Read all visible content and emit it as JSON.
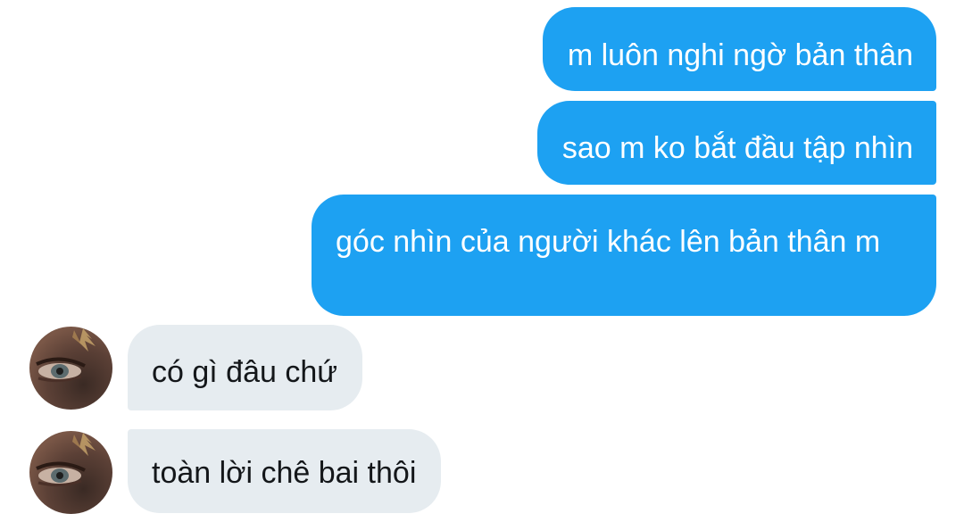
{
  "messages": [
    {
      "direction": "sent",
      "text": "m luôn nghi ngờ bản thân"
    },
    {
      "direction": "sent",
      "text": "sao m ko bắt đầu tập nhìn"
    },
    {
      "direction": "sent",
      "text": "góc nhìn của người khác lên bản thân m"
    },
    {
      "direction": "received",
      "text": "có gì đâu chứ"
    },
    {
      "direction": "received",
      "text": "toàn lời chê bai thôi"
    }
  ],
  "colors": {
    "sent_bubble": "#1da1f2",
    "sent_text": "#ffffff",
    "received_bubble": "#e6ecf0",
    "received_text": "#14171a"
  }
}
